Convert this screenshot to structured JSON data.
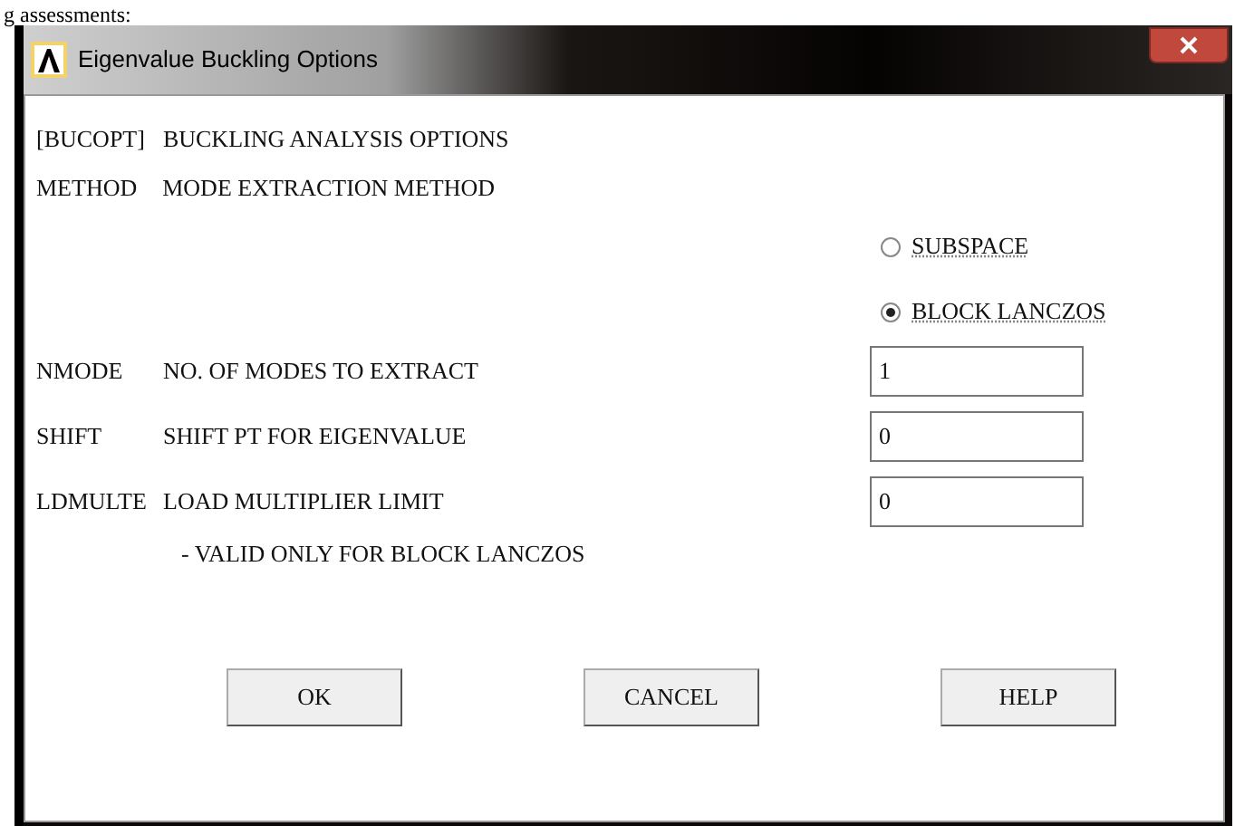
{
  "document_text": "g assessments:",
  "window": {
    "title": "Eigenvalue Buckling Options"
  },
  "heading": {
    "command": "[BUCOPT]",
    "label": "BUCKLING ANALYSIS OPTIONS"
  },
  "method": {
    "key": "METHOD",
    "label": "MODE EXTRACTION METHOD",
    "options": [
      {
        "label": "SUBSPACE",
        "selected": false
      },
      {
        "label": "BLOCK LANCZOS",
        "selected": true
      }
    ]
  },
  "fields": [
    {
      "key": "NMODE",
      "label": "NO. OF MODES TO EXTRACT",
      "value": "1"
    },
    {
      "key": "SHIFT",
      "label": "SHIFT PT FOR EIGENVALUE",
      "value": "0"
    },
    {
      "key": "LDMULTE",
      "label": "LOAD MULTIPLIER LIMIT",
      "value": "0"
    }
  ],
  "note": "- VALID ONLY FOR BLOCK LANCZOS",
  "buttons": [
    "OK",
    "CANCEL",
    "HELP"
  ]
}
